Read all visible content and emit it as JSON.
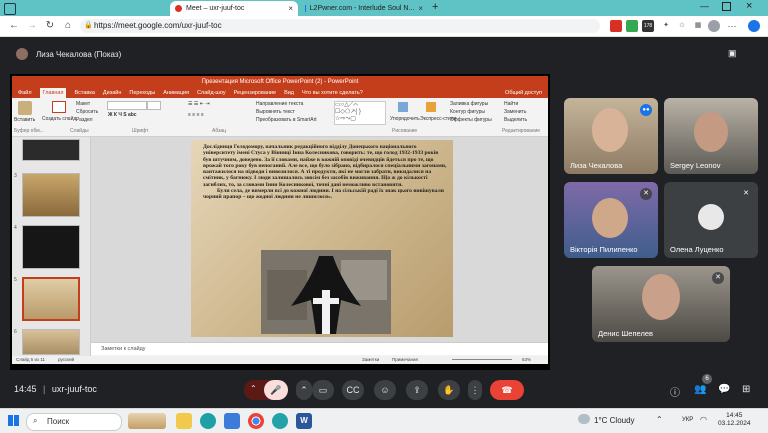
{
  "browser": {
    "tabs": [
      {
        "title": "Meet – uxr-juuf-toc",
        "active": true
      },
      {
        "title": "L2Pwner.com - Interlude Soul N...",
        "active": false
      }
    ],
    "url": "https://meet.google.com/uxr-juuf-toc",
    "ext_badge": "178"
  },
  "meet": {
    "presenter_label": "Лиза Чекалова (Показ)",
    "time": "14:45",
    "separator": "|",
    "code": "uxr-juuf-toc",
    "participants_badge": "6"
  },
  "ppt": {
    "title": "Презентация Microsoft Office PowerPoint (2) - PowerPoint",
    "tabs": [
      "Файл",
      "Главная",
      "Вставка",
      "Дизайн",
      "Переходы",
      "Анимация",
      "Слайд-шоу",
      "Рецензирование",
      "Вид",
      "Что вы хотите сделать?"
    ],
    "share": "Общий доступ",
    "ribbon": {
      "paste": "Вставить",
      "new_slide": "Создать слайд",
      "layout": "Макет",
      "reset": "Сбросить",
      "section": "Раздел",
      "group_clipboard": "Буфер обм...",
      "group_slides": "Слайды",
      "group_font": "Шрифт",
      "group_paragraph": "Абзац",
      "direction": "Направление текста",
      "align": "Выровнять текст",
      "smartart": "Преобразовать в SmartArt",
      "group_drawing": "Рисование",
      "arrange": "Упорядочить",
      "styles": "Экспресс-стили",
      "fill": "Заливка фигуры",
      "outline": "Контур фигуры",
      "effects": "Эффекты фигуры",
      "find": "Найти",
      "replace": "Заменить",
      "select": "Выделить",
      "group_edit": "Редактирование"
    },
    "slide_numbers": [
      "3",
      "4",
      "5",
      "6"
    ],
    "slide_text": "Дослідниця Голодомору, начальник редакційного відділу Донецького національного університету імені Стуса у Вінниці Інна Колесникова, говорить: те, що голод 1932-1933 років був штучним, доведено. За її словами, найже в кожній оповіді очевидців йдеться про те, що врожай того року був непоганий. Але все, що було зібрано, відбиралося спеціальними загонами, вантажилося на підводи і вивозилося. А ті продукти, які не могли забрати, викидалися на смітник, у багнюку. І люди залишались зовсім без засобів виживання. Що ж до кількості загиблих, то, за словами Інни Колесникової, точні дані неможливо встановити.",
    "slide_text2": "Були села, де вимерли всі до кожної людини. І на сільській раді їх знак цього вивішували чорний прапор – що жодної людини не лишилося».",
    "notes_placeholder": "Заметки к слайду",
    "status_left": "Слайд 5 из 11",
    "status_lang": "русский",
    "status_notes": "Заметки",
    "status_comments": "Примечания",
    "zoom": "63%"
  },
  "participants": [
    {
      "name": "Лиза Чекалова"
    },
    {
      "name": "Sergey Leonov"
    },
    {
      "name": "Вікторія Пилипенко"
    },
    {
      "name": "Олена Луценко"
    },
    {
      "name": "Денис Шепелев"
    }
  ],
  "taskbar": {
    "search": "Поиск",
    "weather": "1°C  Cloudy",
    "lang": "УКР",
    "time": "14:45",
    "date": "03.12.2024"
  },
  "colors": {
    "meet_bg": "#202124",
    "ppt_accent": "#c43e1c",
    "hangup": "#ea4335",
    "mic_off": "#5c1a16"
  }
}
